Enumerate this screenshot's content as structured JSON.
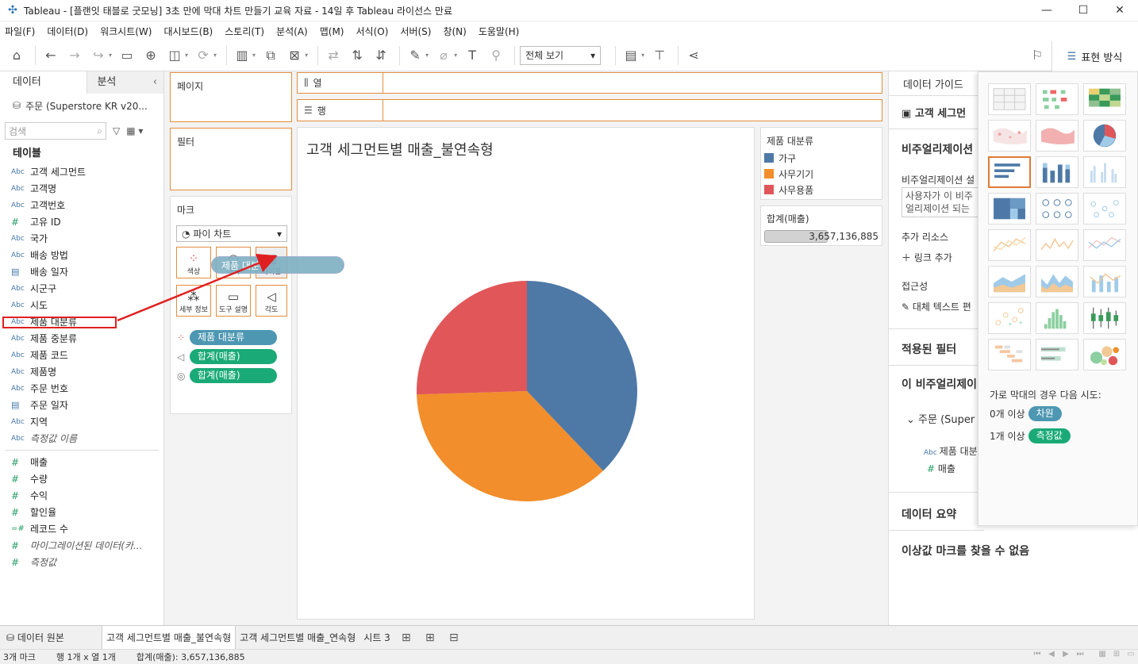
{
  "window": {
    "title": "Tableau - [플랜잇 태블로 굿모닝] 3초 만에 막대 차트 만들기 교육 자료 - 14일 후 Tableau 라이선스 만료",
    "minimize": "—",
    "maximize": "☐",
    "close": "✕"
  },
  "menu": [
    "파일(F)",
    "데이터(D)",
    "워크시트(W)",
    "대시보드(B)",
    "스토리(T)",
    "분석(A)",
    "맵(M)",
    "서식(O)",
    "서버(S)",
    "창(N)",
    "도움말(H)"
  ],
  "toolbar": {
    "view_select": "전체 보기",
    "format_tab": "표현 방식"
  },
  "data_pane": {
    "tab_data": "데이터",
    "tab_analysis": "분석",
    "datasource": "주문 (Superstore KR v20...",
    "search_placeholder": "검색",
    "tables_label": "테이블",
    "dimensions": [
      {
        "type": "Abc",
        "name": "고객 세그먼트"
      },
      {
        "type": "Abc",
        "name": "고객명"
      },
      {
        "type": "Abc",
        "name": "고객번호"
      },
      {
        "type": "#",
        "name": "고유 ID"
      },
      {
        "type": "Abc",
        "name": "국가"
      },
      {
        "type": "Abc",
        "name": "배송 방법"
      },
      {
        "type": "date",
        "name": "배송 일자"
      },
      {
        "type": "Abc",
        "name": "시군구"
      },
      {
        "type": "Abc",
        "name": "시도"
      },
      {
        "type": "Abc",
        "name": "제품 대분류"
      },
      {
        "type": "Abc",
        "name": "제품 중분류"
      },
      {
        "type": "Abc",
        "name": "제품 코드"
      },
      {
        "type": "Abc",
        "name": "제품명"
      },
      {
        "type": "Abc",
        "name": "주문 번호"
      },
      {
        "type": "date",
        "name": "주문 일자"
      },
      {
        "type": "Abc",
        "name": "지역"
      },
      {
        "type": "Abc",
        "name": "측정값 이름",
        "italic": true
      }
    ],
    "measures": [
      {
        "type": "#",
        "name": "매출"
      },
      {
        "type": "#",
        "name": "수량"
      },
      {
        "type": "#",
        "name": "수익"
      },
      {
        "type": "#",
        "name": "할인율"
      },
      {
        "type": "=#",
        "name": "레코드 수"
      },
      {
        "type": "#",
        "name": "마이그레이션된 데이터(카...",
        "italic": true
      },
      {
        "type": "#",
        "name": "측정값",
        "italic": true
      }
    ]
  },
  "shelves": {
    "pages": "페이지",
    "filters": "필터",
    "marks": "마크",
    "mark_type": "파이 차트",
    "columns": "열",
    "rows": "행",
    "mark_buttons": {
      "color": "색상",
      "size": "크기",
      "label": "레이블",
      "detail": "세부 정보",
      "tooltip": "도구 설명",
      "angle": "각도"
    },
    "pills": [
      {
        "icon": "color",
        "label": "제품 대분류",
        "kind": "dim"
      },
      {
        "icon": "angle",
        "label": "합계(매출)",
        "kind": "meas"
      },
      {
        "icon": "size",
        "label": "합계(매출)",
        "kind": "meas"
      }
    ],
    "drag_pill": "제품 대분류"
  },
  "view": {
    "sheet_title": "고객 세그먼트별 매출_불연속형"
  },
  "chart_data": {
    "type": "pie",
    "title": "고객 세그먼트별 매출_불연속형",
    "categories": [
      "가구",
      "사무기기",
      "사무용품"
    ],
    "values": [
      1385000000,
      1340000000,
      932136885
    ],
    "colors": [
      "#4e79a7",
      "#f28e2b",
      "#e15759"
    ],
    "legend_title": "제품 대분류",
    "size_legend_title": "합계(매출)",
    "total": 3657136885
  },
  "legend": {
    "title": "제품 대분류",
    "items": [
      {
        "label": "가구",
        "color": "#4e79a7"
      },
      {
        "label": "사무기기",
        "color": "#f28e2b"
      },
      {
        "label": "사무용품",
        "color": "#e15759"
      }
    ],
    "size_title": "합계(매출)",
    "size_value": "3,657,136,885",
    "size_fill_fraction": 0.55
  },
  "guide": {
    "tab": "데이터 가이드",
    "sheet_name": "고객 세그먼",
    "viz_desc_head": "비주얼리제이션",
    "viz_desc_label": "비주얼리제이션 설",
    "viz_desc_box": "사용자가 이 비주얼리제이션 되는 설명을 입력",
    "more_resources": "추가 리소스",
    "add_link": "링크 추가",
    "accessibility": "접근성",
    "alt_text": "대체 텍스트 편",
    "applied_filters": "적용된 필터",
    "this_viz": "이 비주얼리제이",
    "source": "주문 (Super",
    "field_dim": "제품 대분",
    "field_meas": "매출",
    "data_summary": "데이터 요약",
    "outliers": "이상값 마크를 찾을 수 없음"
  },
  "showme": {
    "hint": "가로 막대의 경우 다음 시도:",
    "dim_row_prefix": "0개 이상",
    "dim_pill": "차원",
    "meas_row_prefix": "1개 이상",
    "meas_pill": "측정값"
  },
  "sheet_tabs": {
    "datasource": "데이터 원본",
    "tabs": [
      "고객 세그먼트별 매출_불연속형",
      "고객 세그먼트별 매출_연속형",
      "시트 3"
    ]
  },
  "status": {
    "marks": "3개 마크",
    "rows_cols": "행 1개  x  열 1개",
    "sum": "합계(매출): 3,657,136,885"
  }
}
